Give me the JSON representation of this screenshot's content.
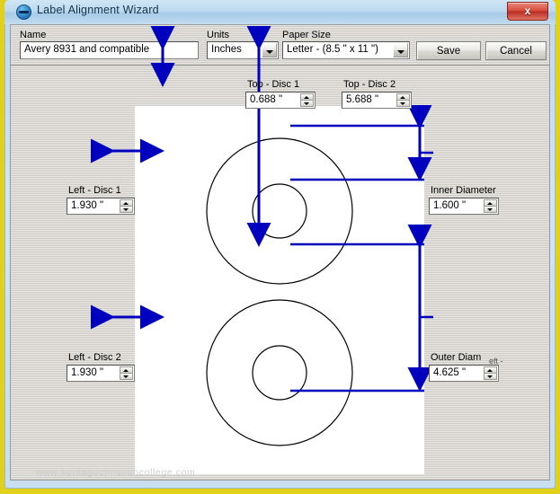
{
  "window": {
    "title": "Label Alignment Wizard",
    "title_icon": "disc-icon",
    "close_label": "x"
  },
  "toolbar": {
    "name_label": "Name",
    "name_value": "Avery 8931 and compatible",
    "units_label": "Units",
    "units_value": "Inches",
    "paper_size_label": "Paper Size",
    "paper_size_value": "Letter - (8.5 \" x 11 \")",
    "save_label": "Save",
    "cancel_label": "Cancel"
  },
  "measurements": {
    "top_disc_1": {
      "label": "Top - Disc 1",
      "value": "0.688 \""
    },
    "top_disc_2": {
      "label": "Top - Disc 2",
      "value": "5.688 \""
    },
    "left_disc_1": {
      "label": "Left - Disc 1",
      "value": "1.930 \""
    },
    "left_disc_2": {
      "label": "Left - Disc 2",
      "value": "1.930 \""
    },
    "inner_diameter": {
      "label": "Inner Diameter",
      "value": "1.600 \""
    },
    "outer_diameter": {
      "label": "Outer Diam",
      "label_artifact": "eft -",
      "value": "4.625 \""
    }
  },
  "canvas": {
    "watermark": "www.heritagechristiancollege.com"
  },
  "colors": {
    "arrow_blue": "#0000bf",
    "paper_white": "#ffffff",
    "dialog_gray": "#d6d3ce",
    "title_blue": "#bcd9ee",
    "frame_yellow": "#e2d11a",
    "close_red": "#d5493a"
  }
}
